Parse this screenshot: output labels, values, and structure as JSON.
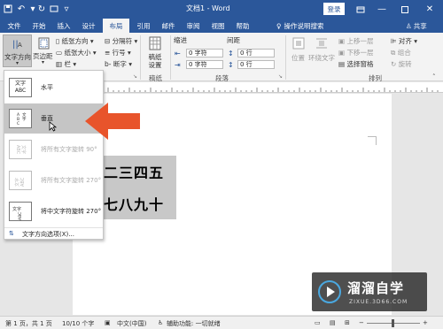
{
  "titlebar": {
    "doc_title": "文档1 - Word",
    "login": "登录"
  },
  "tabs": [
    "文件",
    "开始",
    "插入",
    "设计",
    "布局",
    "引用",
    "邮件",
    "审阅",
    "视图",
    "帮助"
  ],
  "active_tab": "布局",
  "tell_me": "操作说明搜索",
  "share": "共享",
  "ribbon": {
    "text_direction": "文字方向",
    "margins": "页边距",
    "orientation": "纸张方向",
    "size": "纸张大小",
    "columns": "栏",
    "breaks": "分隔符",
    "line_numbers": "行号",
    "hyphenation": "断字",
    "draft_paper": "稿纸设置",
    "draft_paper_group": "稿纸",
    "indent": "缩进",
    "spacing": "间距",
    "indent_left": "0 字符",
    "indent_right": "0 字符",
    "spacing_before": "0 行",
    "spacing_after": "0 行",
    "paragraph_group": "段落",
    "position": "位置",
    "wrap_text": "环绕文字",
    "bring_forward": "上移一层",
    "send_backward": "下移一层",
    "selection_pane": "选择窗格",
    "align": "对齐",
    "group": "组合",
    "rotate": "旋转",
    "arrange_group": "排列"
  },
  "menu": {
    "items": [
      {
        "label": "水平",
        "icon_text": "文字ABC"
      },
      {
        "label": "垂直",
        "icon_text": "文字ABC"
      },
      {
        "label": "将所有文字旋转 90°",
        "icon_text": "文字ABC"
      },
      {
        "label": "将所有文字旋转 270°",
        "icon_text": "文字ABC"
      },
      {
        "label": "将中文字符旋转 270°",
        "icon_text": "文字ABC"
      }
    ],
    "options": "文字方向选项(X)..."
  },
  "document": {
    "line1": "二三四五",
    "line2": "七八九十"
  },
  "status": {
    "page": "第 1 页，共 1 页",
    "words": "10/10 个字",
    "language": "中文(中国)",
    "accessibility": "辅助功能: 一切就绪"
  },
  "watermark": {
    "brand": "溜溜自学",
    "url": "ZIXUE.3D66.COM"
  },
  "colors": {
    "word_blue": "#2b579a",
    "arrow_red": "#e8542b"
  }
}
